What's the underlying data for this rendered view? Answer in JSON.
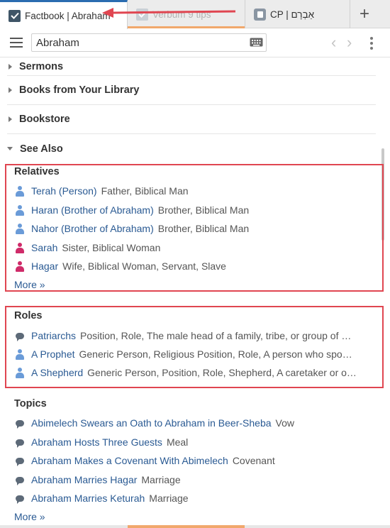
{
  "tabs": [
    {
      "label": "Factbook | Abraham",
      "icon": "checkbox-icon"
    },
    {
      "label": "Verbum 9 tips",
      "icon": "checkbox-icon"
    },
    {
      "label": "CP | אַבְרָם",
      "icon": "cp-icon"
    }
  ],
  "new_tab_label": "+",
  "search": {
    "value": "Abraham"
  },
  "sections": [
    {
      "label": "Sermons",
      "state": "collapsed"
    },
    {
      "label": "Books from Your Library",
      "state": "collapsed"
    },
    {
      "label": "Bookstore",
      "state": "collapsed"
    },
    {
      "label": "See Also",
      "state": "expanded"
    }
  ],
  "relatives": {
    "title": "Relatives",
    "items": [
      {
        "name": "Terah (Person)",
        "desc": "Father, Biblical Man",
        "gender": "male"
      },
      {
        "name": "Haran (Brother of Abraham)",
        "desc": "Brother, Biblical Man",
        "gender": "male"
      },
      {
        "name": "Nahor (Brother of Abraham)",
        "desc": "Brother, Biblical Man",
        "gender": "male"
      },
      {
        "name": "Sarah",
        "desc": "Sister, Biblical Woman",
        "gender": "female"
      },
      {
        "name": "Hagar",
        "desc": "Wife, Biblical Woman, Servant, Slave",
        "gender": "female"
      }
    ],
    "more": "More »"
  },
  "roles": {
    "title": "Roles",
    "items": [
      {
        "name": "Patriarchs",
        "desc": "Position, Role, The male head of a family, tribe, or group of …",
        "icon": "bubble"
      },
      {
        "name": "A Prophet",
        "desc": "Generic Person, Religious Position, Role, A person who spo…",
        "icon": "male"
      },
      {
        "name": "A Shepherd",
        "desc": "Generic Person, Position, Role, Shepherd, A caretaker or o…",
        "icon": "male"
      }
    ]
  },
  "topics": {
    "title": "Topics",
    "items": [
      {
        "name": "Abimelech Swears an Oath to Abraham in Beer-Sheba",
        "desc": "Vow"
      },
      {
        "name": "Abraham Hosts Three Guests",
        "desc": "Meal"
      },
      {
        "name": "Abraham Makes a Covenant With Abimelech",
        "desc": "Covenant"
      },
      {
        "name": "Abraham Marries Hagar",
        "desc": "Marriage"
      },
      {
        "name": "Abraham Marries Keturah",
        "desc": "Marriage"
      }
    ],
    "more": "More »"
  },
  "colors": {
    "link": "#2a5a93",
    "annotation": "#e04651",
    "male_icon": "#6a9bd8",
    "female_icon": "#cf2b69",
    "tab_accent": "#f1a86c"
  }
}
